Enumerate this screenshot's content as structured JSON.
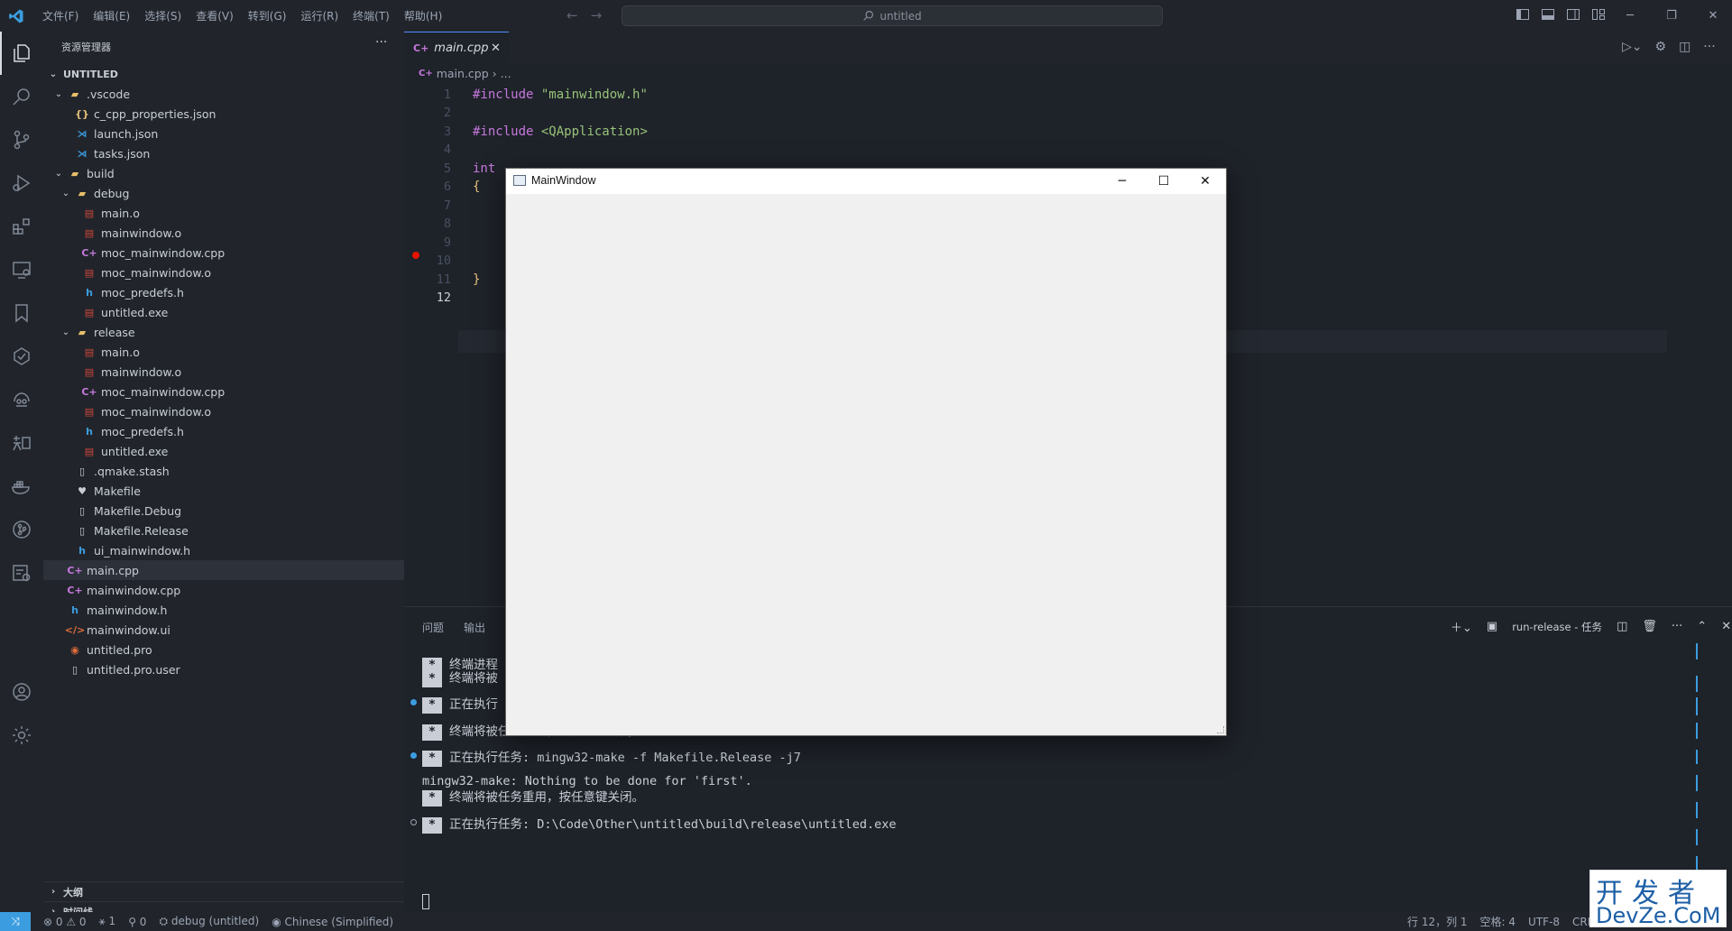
{
  "titlebar": {
    "menu": [
      "文件(F)",
      "编辑(E)",
      "选择(S)",
      "查看(V)",
      "转到(G)",
      "运行(R)",
      "终端(T)",
      "帮助(H)"
    ],
    "search_text": "untitled"
  },
  "sidebar": {
    "header": "资源管理器",
    "root": "UNTITLED",
    "tree": [
      {
        "label": ".vscode",
        "depth": 1,
        "icon": "folder",
        "chevron": "v"
      },
      {
        "label": "c_cpp_properties.json",
        "depth": 2,
        "icon": "json"
      },
      {
        "label": "launch.json",
        "depth": 2,
        "icon": "vscode"
      },
      {
        "label": "tasks.json",
        "depth": 2,
        "icon": "vscode"
      },
      {
        "label": "build",
        "depth": 1,
        "icon": "folder",
        "chevron": "v"
      },
      {
        "label": "debug",
        "depth": 2,
        "icon": "folder",
        "chevron": "v"
      },
      {
        "label": "main.o",
        "depth": 3,
        "icon": "obj"
      },
      {
        "label": "mainwindow.o",
        "depth": 3,
        "icon": "obj"
      },
      {
        "label": "moc_mainwindow.cpp",
        "depth": 3,
        "icon": "cpp"
      },
      {
        "label": "moc_mainwindow.o",
        "depth": 3,
        "icon": "obj"
      },
      {
        "label": "moc_predefs.h",
        "depth": 3,
        "icon": "h"
      },
      {
        "label": "untitled.exe",
        "depth": 3,
        "icon": "exe"
      },
      {
        "label": "release",
        "depth": 2,
        "icon": "folder",
        "chevron": "v"
      },
      {
        "label": "main.o",
        "depth": 3,
        "icon": "obj"
      },
      {
        "label": "mainwindow.o",
        "depth": 3,
        "icon": "obj"
      },
      {
        "label": "moc_mainwindow.cpp",
        "depth": 3,
        "icon": "cpp"
      },
      {
        "label": "moc_mainwindow.o",
        "depth": 3,
        "icon": "obj"
      },
      {
        "label": "moc_predefs.h",
        "depth": 3,
        "icon": "h"
      },
      {
        "label": "untitled.exe",
        "depth": 3,
        "icon": "exe"
      },
      {
        "label": ".qmake.stash",
        "depth": 2,
        "icon": "file"
      },
      {
        "label": "Makefile",
        "depth": 2,
        "icon": "make"
      },
      {
        "label": "Makefile.Debug",
        "depth": 2,
        "icon": "file"
      },
      {
        "label": "Makefile.Release",
        "depth": 2,
        "icon": "file"
      },
      {
        "label": "ui_mainwindow.h",
        "depth": 2,
        "icon": "h"
      },
      {
        "label": "main.cpp",
        "depth": 1,
        "icon": "cpp",
        "selected": true
      },
      {
        "label": "mainwindow.cpp",
        "depth": 1,
        "icon": "cpp"
      },
      {
        "label": "mainwindow.h",
        "depth": 1,
        "icon": "h"
      },
      {
        "label": "mainwindow.ui",
        "depth": 1,
        "icon": "ui"
      },
      {
        "label": "untitled.pro",
        "depth": 1,
        "icon": "pro"
      },
      {
        "label": "untitled.pro.user",
        "depth": 1,
        "icon": "file"
      }
    ],
    "outline": "大纲",
    "timeline": "时间线"
  },
  "editor": {
    "tab_label": "main.cpp",
    "breadcrumb_file": "main.cpp",
    "breadcrumb_rest": "...",
    "lines": [
      {
        "n": "1",
        "parts": [
          [
            "kw",
            "#include"
          ],
          [
            "str",
            " \"mainwindow.h\""
          ]
        ]
      },
      {
        "n": "2",
        "parts": []
      },
      {
        "n": "3",
        "parts": [
          [
            "kw",
            "#include"
          ],
          [
            "str",
            " <QApplication>"
          ]
        ]
      },
      {
        "n": "4",
        "parts": []
      },
      {
        "n": "5",
        "parts": [
          [
            "kw",
            "int"
          ]
        ]
      },
      {
        "n": "6",
        "parts": [
          [
            "brace",
            "{"
          ]
        ]
      },
      {
        "n": "7",
        "parts": []
      },
      {
        "n": "8",
        "parts": []
      },
      {
        "n": "9",
        "parts": []
      },
      {
        "n": "10",
        "parts": []
      },
      {
        "n": "11",
        "parts": [
          [
            "brace",
            "}"
          ]
        ]
      },
      {
        "n": "12",
        "parts": [],
        "current": true
      }
    ]
  },
  "panel": {
    "tabs": [
      "问题",
      "输出"
    ],
    "terminal_name": "run-release - 任务",
    "lines": [
      {
        "star": true,
        "text": "终端进程"
      },
      {
        "star": true,
        "text": "终端将被"
      },
      {
        "star": true,
        "text": "正在执行",
        "dot": "blue"
      },
      {
        "star": true,
        "text": "终端将被任务重用，按任意键关闭。"
      },
      {
        "star": true,
        "text": "正在执行任务: mingw32-make -f Makefile.Release -j7",
        "dot": "blue"
      },
      {
        "star": false,
        "text": "mingw32-make: Nothing to be done for 'first'."
      },
      {
        "star": true,
        "text": "终端将被任务重用，按任意键关闭。"
      },
      {
        "star": true,
        "text": "正在执行任务: D:\\Code\\Other\\untitled\\build\\release\\untitled.exe",
        "dot": "hollow"
      }
    ]
  },
  "statusbar": {
    "problems": "⊗ 0 ⚠ 0",
    "git": "⚹ 1",
    "ports": "⚲ 0",
    "debug": "debug (untitled)",
    "language": "Chinese (Simplified)",
    "position": "行 12，列 1",
    "spaces": "空格: 4",
    "encoding": "UTF-8",
    "eol": "CRL"
  },
  "app_window": {
    "title": "MainWindow"
  },
  "watermark": {
    "top": "开发者",
    "bottom": "DevZe.CoM"
  }
}
